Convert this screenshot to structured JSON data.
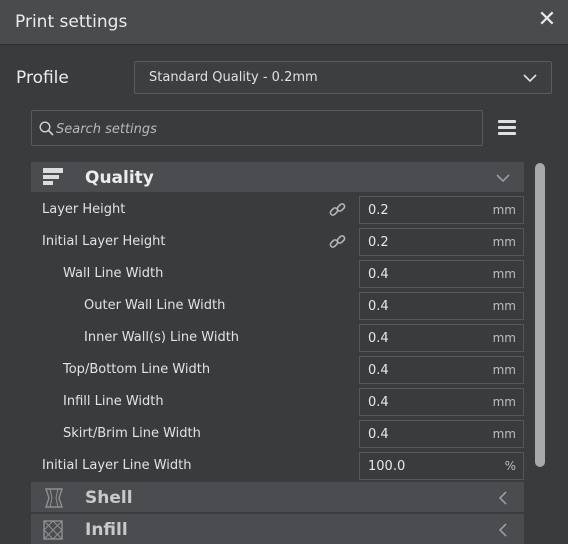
{
  "window": {
    "title": "Print settings",
    "close_icon": "close-icon"
  },
  "profile": {
    "label": "Profile",
    "value": "Standard Quality - 0.2mm"
  },
  "search": {
    "placeholder": "Search settings"
  },
  "categories": {
    "quality": {
      "label": "Quality",
      "icon": "quality-icon",
      "expanded": true
    },
    "shell": {
      "label": "Shell",
      "icon": "shell-icon",
      "expanded": false
    },
    "infill": {
      "label": "Infill",
      "icon": "infill-icon",
      "expanded": false
    }
  },
  "settings": [
    {
      "label": "Layer Height",
      "value": "0.2",
      "unit": "mm",
      "linked": true
    },
    {
      "label": "Initial Layer Height",
      "value": "0.2",
      "unit": "mm",
      "linked": true
    },
    {
      "label": "Wall Line Width",
      "value": "0.4",
      "unit": "mm",
      "linked": false
    },
    {
      "label": "Outer Wall Line Width",
      "value": "0.4",
      "unit": "mm",
      "linked": false
    },
    {
      "label": "Inner Wall(s) Line Width",
      "value": "0.4",
      "unit": "mm",
      "linked": false
    },
    {
      "label": "Top/Bottom Line Width",
      "value": "0.4",
      "unit": "mm",
      "linked": false
    },
    {
      "label": "Infill Line Width",
      "value": "0.4",
      "unit": "mm",
      "linked": false
    },
    {
      "label": "Skirt/Brim Line Width",
      "value": "0.4",
      "unit": "mm",
      "linked": false
    },
    {
      "label": "Initial Layer Line Width",
      "value": "100.0",
      "unit": "%",
      "linked": false
    }
  ],
  "colors": {
    "background": "#3a3b3d",
    "category_header": "#4a4c4f",
    "scrollbar": "#a7a8aa"
  }
}
